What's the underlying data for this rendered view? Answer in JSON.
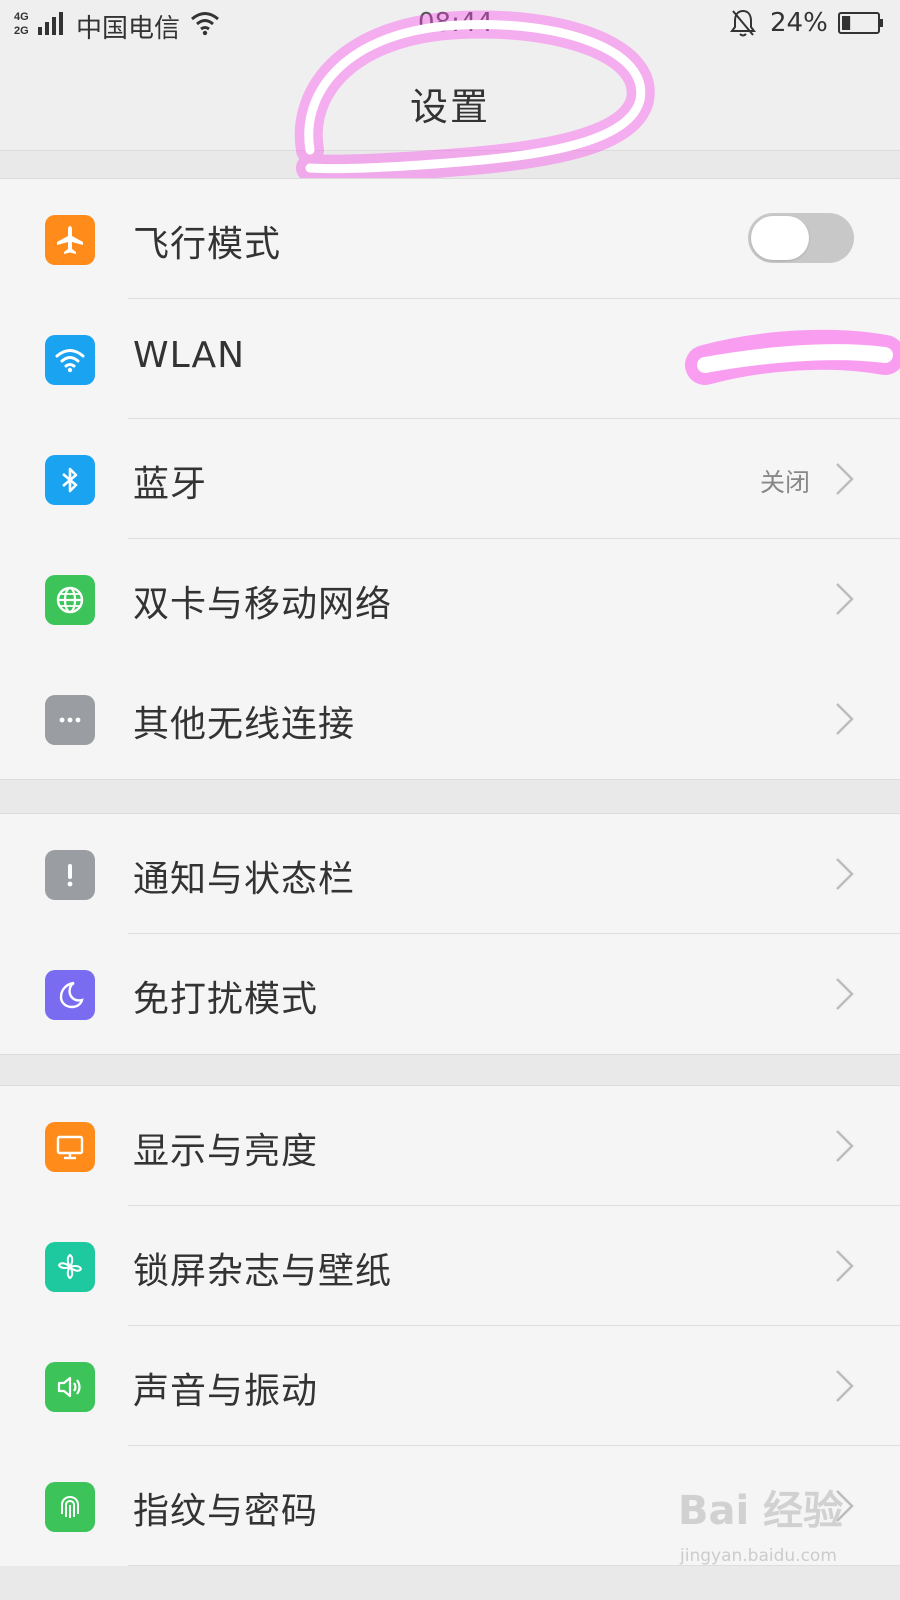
{
  "status_bar": {
    "network_top": "4G",
    "network_bottom": "2G",
    "carrier": "中国电信",
    "time": "08:44",
    "battery": "24%",
    "battery_level": 0.24
  },
  "header": {
    "title": "设置"
  },
  "groups": [
    {
      "items": [
        {
          "label": "飞行模式",
          "icon": "airplane-icon",
          "icon_color": "#ff8c1a",
          "control": "toggle",
          "toggle_on": false
        },
        {
          "label": "WLAN",
          "icon": "wifi-icon",
          "icon_color": "#1aa3f0",
          "control": "none"
        },
        {
          "label": "蓝牙",
          "icon": "bluetooth-icon",
          "icon_color": "#1aa3f0",
          "control": "chevron",
          "value": "关闭"
        },
        {
          "label": "双卡与移动网络",
          "icon": "globe-icon",
          "icon_color": "#3cc45a",
          "control": "chevron"
        },
        {
          "label": "其他无线连接",
          "icon": "more-dots-icon",
          "icon_color": "#9a9ea3",
          "control": "chevron"
        }
      ]
    },
    {
      "items": [
        {
          "label": "通知与状态栏",
          "icon": "exclamation-icon",
          "icon_color": "#9a9ea3",
          "control": "chevron"
        },
        {
          "label": "免打扰模式",
          "icon": "moon-icon",
          "icon_color": "#7a6cf0",
          "control": "chevron"
        }
      ]
    },
    {
      "items": [
        {
          "label": "显示与亮度",
          "icon": "monitor-icon",
          "icon_color": "#ff8c1a",
          "control": "chevron"
        },
        {
          "label": "锁屏杂志与壁纸",
          "icon": "pinwheel-icon",
          "icon_color": "#1ec9a0",
          "control": "chevron"
        },
        {
          "label": "声音与振动",
          "icon": "speaker-icon",
          "icon_color": "#3cc45a",
          "control": "chevron"
        },
        {
          "label": "指纹与密码",
          "icon": "fingerprint-icon",
          "icon_color": "#3cc45a",
          "control": "chevron"
        }
      ]
    }
  ],
  "watermark": {
    "brand": "Bai 经验",
    "site": "jingyan.baidu.com"
  }
}
